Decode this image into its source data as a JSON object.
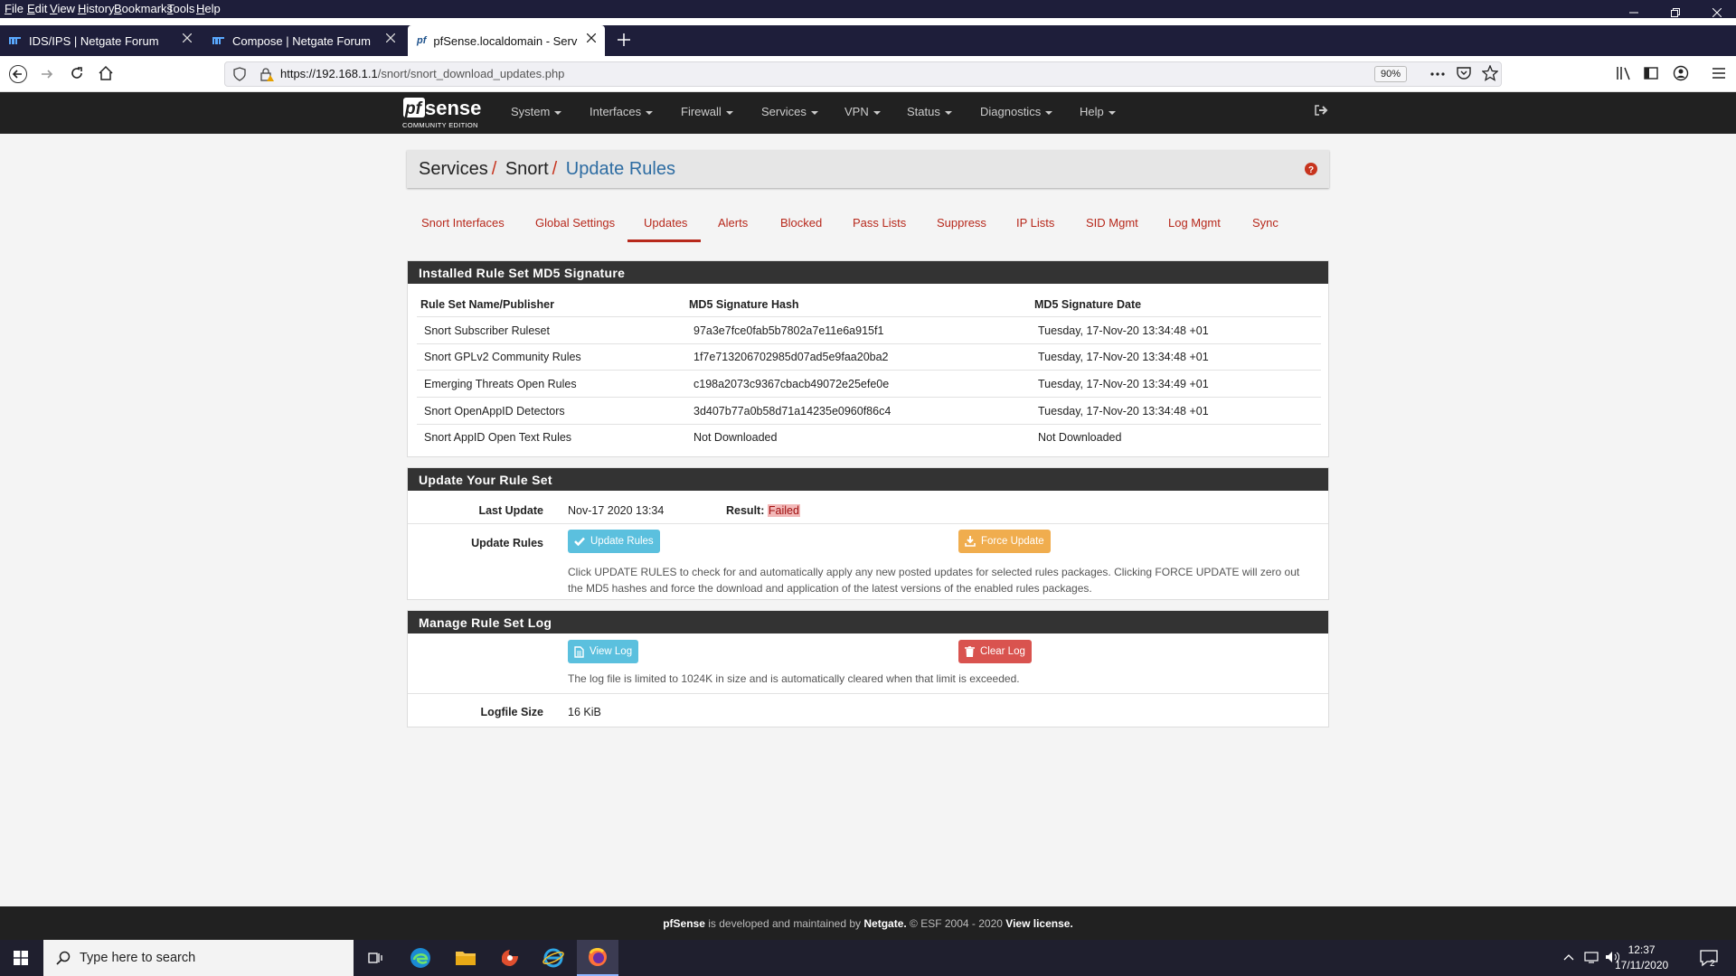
{
  "browser": {
    "menu": [
      "File",
      "Edit",
      "View",
      "History",
      "Bookmarks",
      "Tools",
      "Help"
    ],
    "tabs": [
      {
        "label": "IDS/IPS | Netgate Forum",
        "icon": "netgate-icon"
      },
      {
        "label": "Compose | Netgate Forum",
        "icon": "netgate-icon"
      },
      {
        "label": "pfSense.localdomain - Services",
        "icon": "pfsense-icon"
      }
    ],
    "url_host": "https://192.168.1.1",
    "url_path": "/snort/snort_download_updates.php",
    "zoom": "90%"
  },
  "pfsense": {
    "logo": "pfsense",
    "logo_sub": "COMMUNITY EDITION",
    "menu": [
      "System",
      "Interfaces",
      "Firewall",
      "Services",
      "VPN",
      "Status",
      "Diagnostics",
      "Help"
    ],
    "breadcrumb": {
      "part1": "Services",
      "part2": "Snort",
      "current": "Update Rules",
      "sep": "/"
    },
    "tabs": [
      "Snort Interfaces",
      "Global Settings",
      "Updates",
      "Alerts",
      "Blocked",
      "Pass Lists",
      "Suppress",
      "IP Lists",
      "SID Mgmt",
      "Log Mgmt",
      "Sync"
    ],
    "installed": {
      "title": "Installed Rule Set MD5 Signature",
      "headers": [
        "Rule Set Name/Publisher",
        "MD5 Signature Hash",
        "MD5 Signature Date"
      ],
      "rows": [
        [
          "Snort Subscriber Ruleset",
          "97a3e7fce0fab5b7802a7e11e6a915f1",
          "Tuesday, 17-Nov-20 13:34:48 +01"
        ],
        [
          "Snort GPLv2 Community Rules",
          "1f7e713206702985d07ad5e9faa20ba2",
          "Tuesday, 17-Nov-20 13:34:48 +01"
        ],
        [
          "Emerging Threats Open Rules",
          "c198a2073c9367cbacb49072e25efe0e",
          "Tuesday, 17-Nov-20 13:34:49 +01"
        ],
        [
          "Snort OpenAppID Detectors",
          "3d407b77a0b58d71a14235e0960f86c4",
          "Tuesday, 17-Nov-20 13:34:48 +01"
        ],
        [
          "Snort AppID Open Text Rules",
          "Not Downloaded",
          "Not Downloaded"
        ]
      ]
    },
    "update": {
      "title": "Update Your Rule Set",
      "last_update_label": "Last Update",
      "last_update_value": "Nov-17 2020 13:34",
      "result_label": "Result:",
      "result_value": "Failed",
      "update_rules_label": "Update Rules",
      "update_button": "Update Rules",
      "force_button": "Force Update",
      "help_line1": "Click UPDATE RULES to check for and automatically apply any new posted updates for selected rules packages. Clicking FORCE UPDATE will zero out",
      "help_line2": "the MD5 hashes and force the download and application of the latest versions of the enabled rules packages."
    },
    "log": {
      "title": "Manage Rule Set Log",
      "view_button": "View Log",
      "clear_button": "Clear Log",
      "help": "The log file is limited to 1024K in size and is automatically cleared when that limit is exceeded.",
      "size_label": "Logfile Size",
      "size_value": "16 KiB"
    },
    "footer": {
      "brand": "pfSense",
      "text1": " is developed and maintained by ",
      "company": "Netgate.",
      "text2": " © ESF 2004 - 2020 ",
      "license": "View license."
    }
  },
  "taskbar": {
    "search_placeholder": "Type here to search",
    "time": "12:37",
    "date": "17/11/2020",
    "notifications": "2"
  },
  "colors": {
    "accent": "#b7281b",
    "link": "#2d6ca2",
    "info": "#5bc0de",
    "warning": "#f0ad4e",
    "danger": "#d9534f",
    "header": "#212121"
  }
}
